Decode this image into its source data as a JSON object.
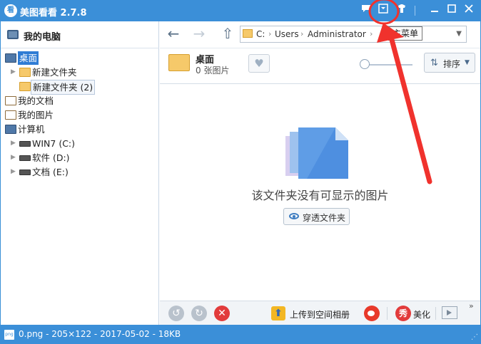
{
  "titlebar": {
    "app_icon_text": "看",
    "title": "美图看看 2.7.8",
    "buttons": [
      "chat-icon",
      "main-menu-icon",
      "skin-icon",
      "minimize-icon",
      "maximize-icon",
      "close-icon"
    ]
  },
  "sidebar": {
    "header": "我的电脑",
    "tree": [
      {
        "label": "桌面",
        "icon": "desktop-icon",
        "selected": true
      },
      {
        "label": "新建文件夹",
        "icon": "folder-icon"
      },
      {
        "label": "新建文件夹 (2)",
        "icon": "folder-icon"
      },
      {
        "label": "我的文档",
        "icon": "documents-icon"
      },
      {
        "label": "我的图片",
        "icon": "pictures-icon"
      },
      {
        "label": "计算机",
        "icon": "computer-icon"
      },
      {
        "label": "WIN7 (C:)",
        "icon": "drive-icon"
      },
      {
        "label": "软件 (D:)",
        "icon": "drive-icon"
      },
      {
        "label": "文档 (E:)",
        "icon": "drive-icon"
      }
    ]
  },
  "nav": {
    "back": "←",
    "forward": "→",
    "up": "⇧",
    "path": [
      "C:",
      "Users",
      "Administrator"
    ],
    "tooltip": "主菜单"
  },
  "folder_info": {
    "name": "桌面",
    "count": "0 张图片",
    "sort_label": "排序"
  },
  "empty_state": {
    "message": "该文件夹没有可显示的图片",
    "button_label": "穿透文件夹"
  },
  "bottom_toolbar": {
    "upload_label": "上传到空间相册",
    "beautify_label": "美化",
    "beautify_icon_text": "秀",
    "more": "»"
  },
  "statusbar": {
    "file_icon_text": "png",
    "text": "0.png - 205×122 - 2017-05-02 - 18KB"
  },
  "colors": {
    "titlebar": "#3b8fd8",
    "selection": "#2f7cd4",
    "annotation": "#f0322d"
  }
}
